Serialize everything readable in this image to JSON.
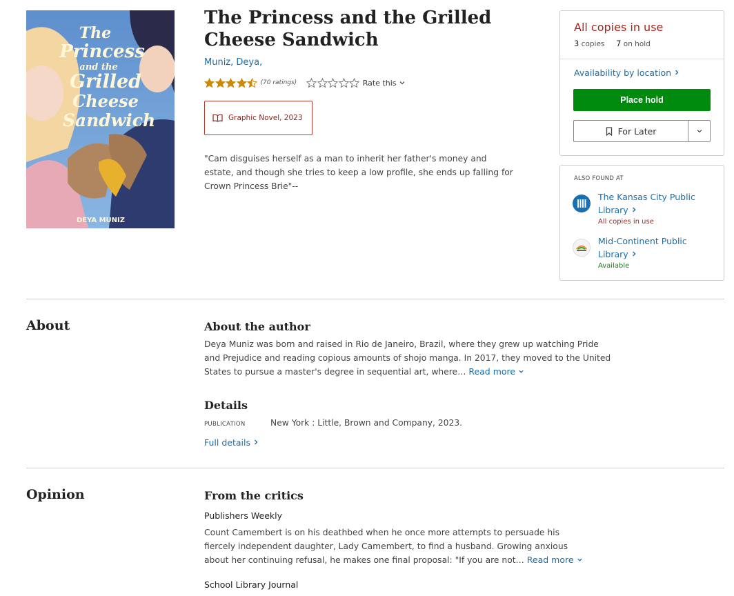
{
  "book": {
    "title": "The Princess and the Grilled Cheese Sandwich",
    "author": "Muniz, Deya,",
    "rating": 4.5,
    "ratings_count": "(70 ratings)",
    "rate_this": "Rate this",
    "format": "Graphic Novel, 2023",
    "description": "\"Cam disguises herself as a man to inherit her father's money and estate, and though she tries to keep a low profile, she ends up falling for Crown Princess Brie\"--",
    "cover": {
      "title_lines": [
        "The",
        "Princess",
        "and the",
        "Grilled",
        "Cheese",
        "Sandwich"
      ],
      "author_text": "DEYA MUNIZ"
    }
  },
  "availability": {
    "status": "All copies in use",
    "copies_num": "3",
    "copies_label": "copies",
    "hold_num": "7",
    "hold_label": "on hold",
    "by_location": "Availability by location",
    "place_hold": "Place hold",
    "for_later": "For Later"
  },
  "also_found": {
    "heading": "ALSO FOUND AT",
    "libraries": [
      {
        "name": "The Kansas City Public Library",
        "status": "All copies in use",
        "status_color": "#a6251a"
      },
      {
        "name": "Mid-Continent Public Library",
        "status": "Available",
        "status_color": "#1e7a1e"
      }
    ]
  },
  "about": {
    "section_label": "About",
    "author_heading": "About the author",
    "author_bio": "Deya Muniz was born and raised in Rio de Janeiro, Brazil, where they grew up watching Pride and Prejudice and reading copious amounts of shojo manga. In 2017, they moved to the United States to pursue a master's degree in sequential art, where…",
    "read_more": "Read more",
    "details_heading": "Details",
    "publication_label": "PUBLICATION",
    "publication_value": "New York : Little, Brown and Company, 2023.",
    "full_details": "Full details"
  },
  "opinion": {
    "section_label": "Opinion",
    "critics_heading": "From the critics",
    "sources": [
      {
        "name": "Publishers Weekly",
        "text": "Count Camembert is on his deathbed when he once more attempts to persuade his fiercely independent daughter, Lady Camembert, to find a husband. Growing anxious about her continuing refusal, he makes one final proposal: \"If you are not…",
        "read_more": "Read more"
      },
      {
        "name": "School Library Journal"
      }
    ]
  },
  "colors": {
    "link": "#1b6ea8",
    "alert": "#a6251a",
    "hold_button": "#008a0e",
    "star": "#c8890c"
  },
  "icons": {
    "format": "open-book-icon",
    "for_later": "bookmark-icon",
    "dropdown": "chevron-down-icon",
    "link_arrow": "chevron-right-icon"
  }
}
